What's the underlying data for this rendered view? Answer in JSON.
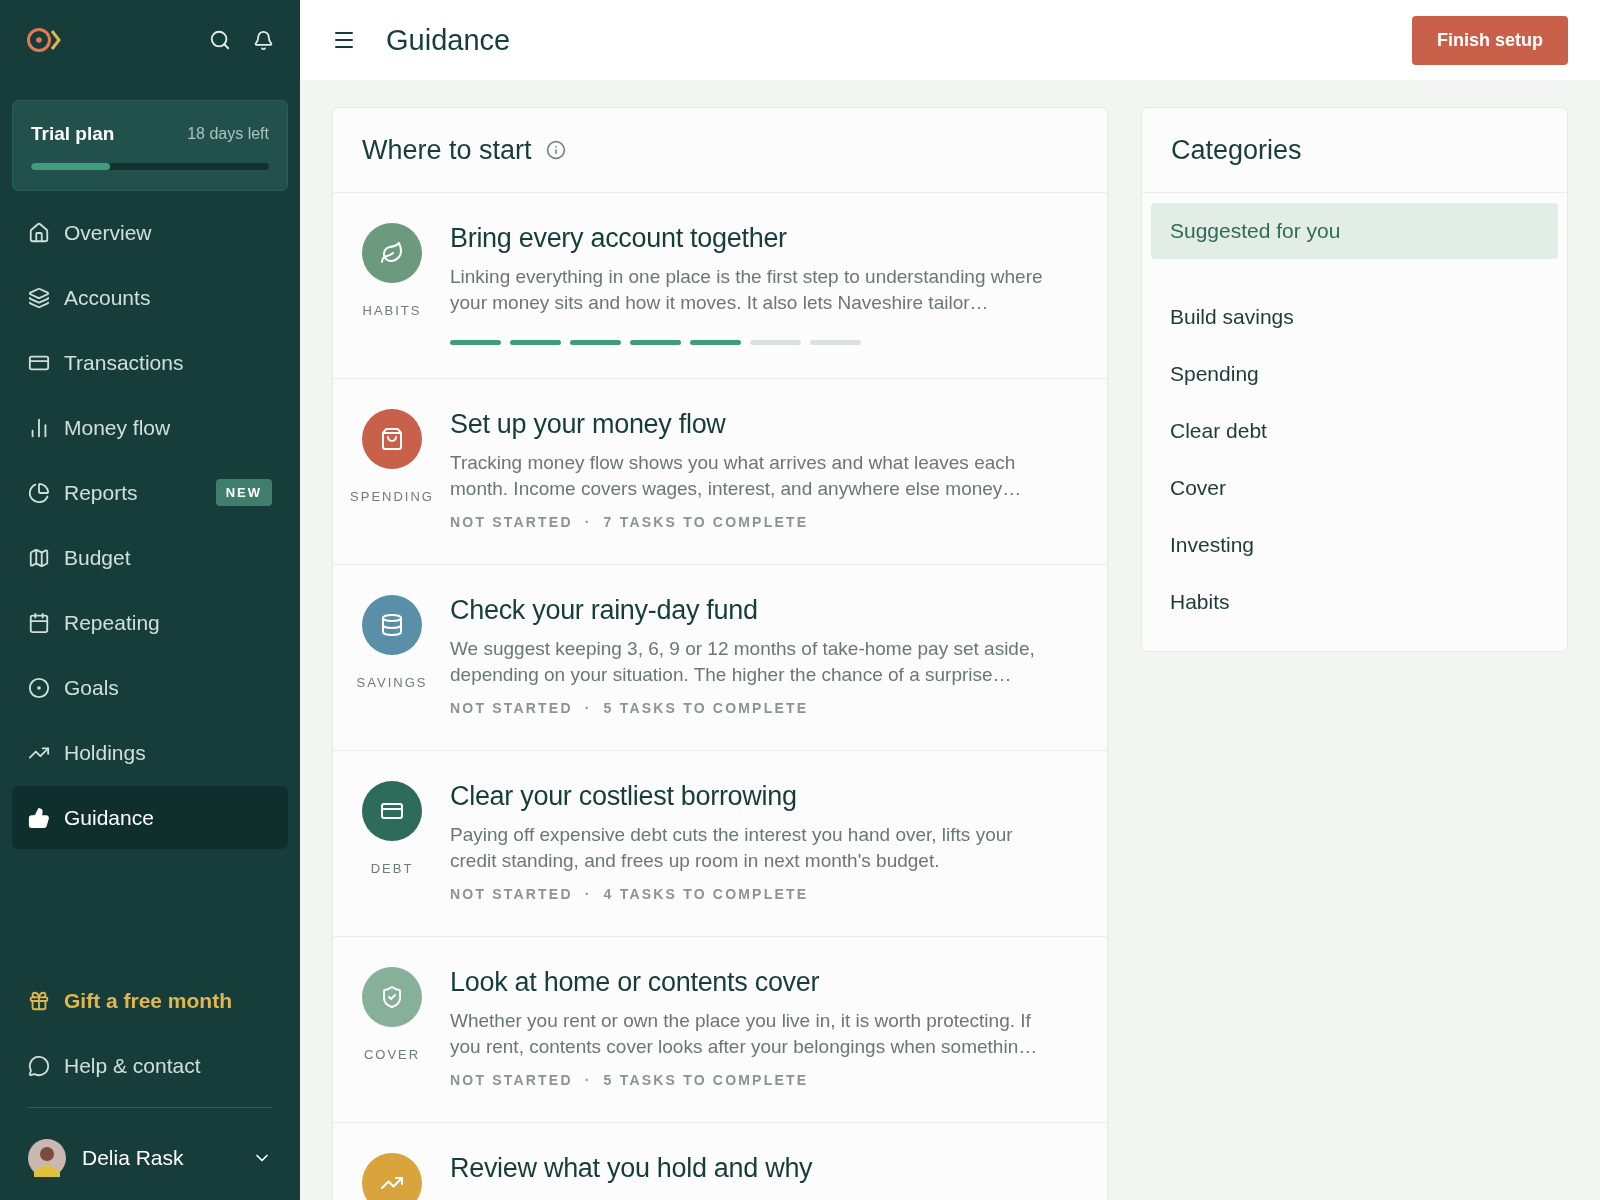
{
  "sidebar": {
    "trial": {
      "title": "Trial plan",
      "remaining": "18 days left",
      "level": 0.33
    },
    "nav": [
      {
        "label": "Overview",
        "selected": false
      },
      {
        "label": "Accounts",
        "selected": false
      },
      {
        "label": "Transactions",
        "selected": false
      },
      {
        "label": "Money flow",
        "selected": false
      },
      {
        "label": "Reports",
        "selected": false,
        "badge": "NEW"
      },
      {
        "label": "Budget",
        "selected": false
      },
      {
        "label": "Repeating",
        "selected": false
      },
      {
        "label": "Goals",
        "selected": false
      },
      {
        "label": "Holdings",
        "selected": false
      },
      {
        "label": "Guidance",
        "selected": true
      }
    ],
    "gift": "Gift a free month",
    "help": "Help & contact",
    "user": {
      "name": "Delia Rask"
    }
  },
  "header": {
    "title": "Guidance",
    "button": "Finish setup"
  },
  "where_to_start": {
    "title": "Where to start",
    "cards": [
      {
        "kind": "progress",
        "category": "HABITS",
        "color": "#6b9a7f",
        "title": "Bring every account together",
        "description": "Linking everything in one place is the first step to understanding where your money sits and how it moves. It also lets Naveshire tailor…",
        "steps": [
          {
            "done": true
          },
          {
            "done": true
          },
          {
            "done": true
          },
          {
            "done": true
          },
          {
            "done": true
          },
          {
            "done": false
          },
          {
            "done": false
          }
        ]
      },
      {
        "kind": "status",
        "category": "SPENDING",
        "color": "#c9614a",
        "title": "Set up your money flow",
        "description": "Tracking money flow shows you what arrives and what leaves each month. Income covers wages, interest, and anywhere else money…",
        "status": "NOT STARTED",
        "separator": "·",
        "tasks": "7 TASKS TO COMPLETE"
      },
      {
        "kind": "status",
        "category": "SAVINGS",
        "color": "#5a8fa8",
        "title": "Check your rainy-day fund",
        "description": "We suggest keeping 3, 6, 9 or 12 months of take-home pay set aside, depending on your situation. The higher the chance of a surprise…",
        "status": "NOT STARTED",
        "separator": "·",
        "tasks": "5 TASKS TO COMPLETE"
      },
      {
        "kind": "status",
        "category": "DEBT",
        "color": "#2d6b5a",
        "title": "Clear your costliest borrowing",
        "description": "Paying off expensive debt cuts the interest you hand over, lifts your credit standing, and frees up room in next month's budget.",
        "status": "NOT STARTED",
        "separator": "·",
        "tasks": "4 TASKS TO COMPLETE"
      },
      {
        "kind": "status",
        "category": "COVER",
        "color": "#87b09a",
        "title": "Look at home or contents cover",
        "description": "Whether you rent or own the place you live in, it is worth protecting. If you rent, contents cover looks after your belongings when somethin…",
        "status": "NOT STARTED",
        "separator": "·",
        "tasks": "5 TASKS TO COMPLETE"
      },
      {
        "kind": "cut",
        "color": "#d9a43c",
        "title": "Review what you hold and why"
      }
    ]
  },
  "categories": {
    "title": "Categories",
    "items": [
      {
        "label": "Suggested for you",
        "selected": true
      },
      {
        "label": "Build savings",
        "selected": false
      },
      {
        "label": "Spending",
        "selected": false
      },
      {
        "label": "Clear debt",
        "selected": false
      },
      {
        "label": "Cover",
        "selected": false
      },
      {
        "label": "Investing",
        "selected": false
      },
      {
        "label": "Habits",
        "selected": false
      }
    ]
  }
}
